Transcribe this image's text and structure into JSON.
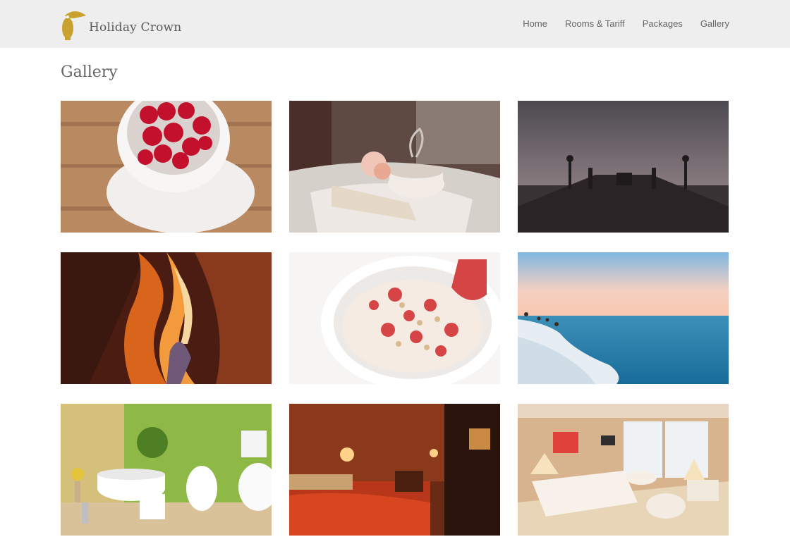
{
  "brand": {
    "name": "Holiday Crown",
    "logo_icon": "toucan-icon",
    "logo_color": "#c9a12e"
  },
  "nav": [
    {
      "label": "Home"
    },
    {
      "label": "Rooms & Tariff"
    },
    {
      "label": "Packages"
    },
    {
      "label": "Gallery"
    }
  ],
  "page": {
    "title": "Gallery"
  },
  "gallery": [
    {
      "subject": "raspberries-in-cup"
    },
    {
      "subject": "tea-cup-with-book"
    },
    {
      "subject": "bridge-at-dusk"
    },
    {
      "subject": "slot-canyon"
    },
    {
      "subject": "strawberry-yogurt-bowl"
    },
    {
      "subject": "sea-cliff-sunset"
    },
    {
      "subject": "green-bathroom"
    },
    {
      "subject": "red-bedroom"
    },
    {
      "subject": "bright-hotel-room"
    }
  ]
}
